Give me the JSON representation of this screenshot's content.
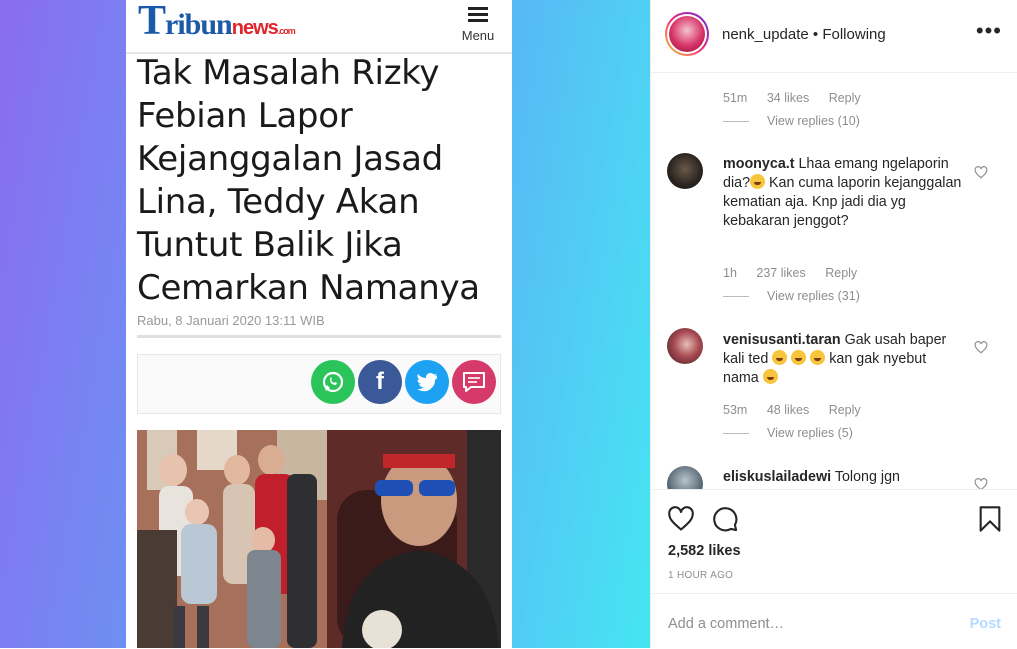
{
  "article": {
    "logo": {
      "t": "T",
      "ribun": "ribun",
      "news": "news",
      "com": ".com"
    },
    "menu_label": "Menu",
    "headline": "Tak Masalah Rizky Febian Lapor Kejanggalan Jasad Lina, Teddy Akan Tuntut Balik Jika Cemarkan Namanya",
    "date": "Rabu, 8 Januari 2020 13:11 WIB",
    "share_buttons": [
      {
        "name": "whatsapp",
        "icon": "whatsapp-icon",
        "color": "#25d366"
      },
      {
        "name": "facebook",
        "icon": "facebook-icon",
        "color": "#3b5998"
      },
      {
        "name": "twitter",
        "icon": "twitter-icon",
        "color": "#1da1f2"
      },
      {
        "name": "comment",
        "icon": "comment-icon",
        "color": "#d63a6b"
      }
    ]
  },
  "post": {
    "username": "nenk_update",
    "separator": " • ",
    "follow_status": "Following",
    "comments": [
      {
        "time": "51m",
        "likes": "34 likes",
        "reply": "Reply",
        "view_replies": "View replies (10)"
      },
      {
        "username": "moonyca.t",
        "text_a": "Lhaa emang ngelaporin dia?",
        "text_b": " Kan cuma laporin kejanggalan kematian aja. Knp jadi dia yg kebakaran jenggot?",
        "time": "1h",
        "likes": "237 likes",
        "reply": "Reply",
        "view_replies": "View replies (31)"
      },
      {
        "username": "venisusanti.taran",
        "text_a": "Gak usah baper kali ted ",
        "text_b": " kan gak nyebut nama ",
        "time": "53m",
        "likes": "48 likes",
        "reply": "Reply",
        "view_replies": "View replies (5)"
      },
      {
        "username": "eliskuslailadewi",
        "text_a": "Tolong jgn"
      }
    ],
    "likes": "2,582 likes",
    "time_ago": "1 HOUR AGO",
    "add_comment_placeholder": "Add a comment…",
    "post_label": "Post"
  }
}
